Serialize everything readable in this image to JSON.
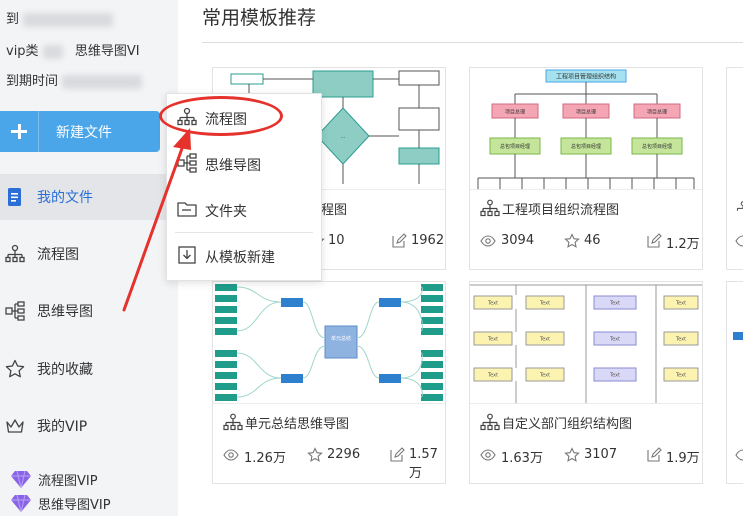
{
  "user": {
    "line1_prefix": "到",
    "line2_prefix": "vip类",
    "line2_value": "思维导图VI",
    "line3_prefix": "到期时间"
  },
  "sidebar": {
    "new_button": "新建文件",
    "items": [
      {
        "label": "我的文件",
        "icon": "file-icon",
        "active": true
      },
      {
        "label": "流程图",
        "icon": "flowchart-icon"
      },
      {
        "label": "思维导图",
        "icon": "mindmap-icon"
      },
      {
        "label": "我的收藏",
        "icon": "star-icon"
      },
      {
        "label": "我的VIP",
        "icon": "crown-icon"
      }
    ],
    "vip_links": [
      {
        "label": "流程图VIP",
        "icon": "diamond-icon"
      },
      {
        "label": "思维导图VIP",
        "icon": "diamond-icon"
      }
    ]
  },
  "main": {
    "section_title": "常用模板推荐",
    "cards": [
      {
        "title": "流程图",
        "views": "10",
        "edits": "1962",
        "likes": ""
      },
      {
        "title": "工程项目组织流程图",
        "views": "3094",
        "likes": "46",
        "edits": "1.2万"
      },
      {
        "title": "单元总结思维导图",
        "views": "1.26万",
        "likes": "2296",
        "edits": "1.57万"
      },
      {
        "title": "自定义部门组织结构图",
        "views": "1.63万",
        "likes": "3107",
        "edits": "1.9万"
      }
    ]
  },
  "menu": {
    "items": [
      {
        "label": "流程图",
        "icon": "flowchart-icon"
      },
      {
        "label": "思维导图",
        "icon": "mindmap-icon"
      },
      {
        "label": "文件夹",
        "icon": "folder-icon"
      },
      {
        "label": "从模板新建",
        "icon": "template-icon"
      }
    ]
  },
  "thumb_text": {
    "org_title": "工程项目管理组织结构",
    "manager": "项目总理",
    "subcontract": "总包项目经理",
    "center_topic": "单元总结",
    "node": "Text",
    "node_center": "单元\n总结"
  },
  "colors": {
    "accent": "#4aa6e8",
    "active_text": "#2b6fd6",
    "highlight": "#e5322d",
    "teal": "#2a9d8f",
    "vip_purple": "#8a64e8"
  }
}
